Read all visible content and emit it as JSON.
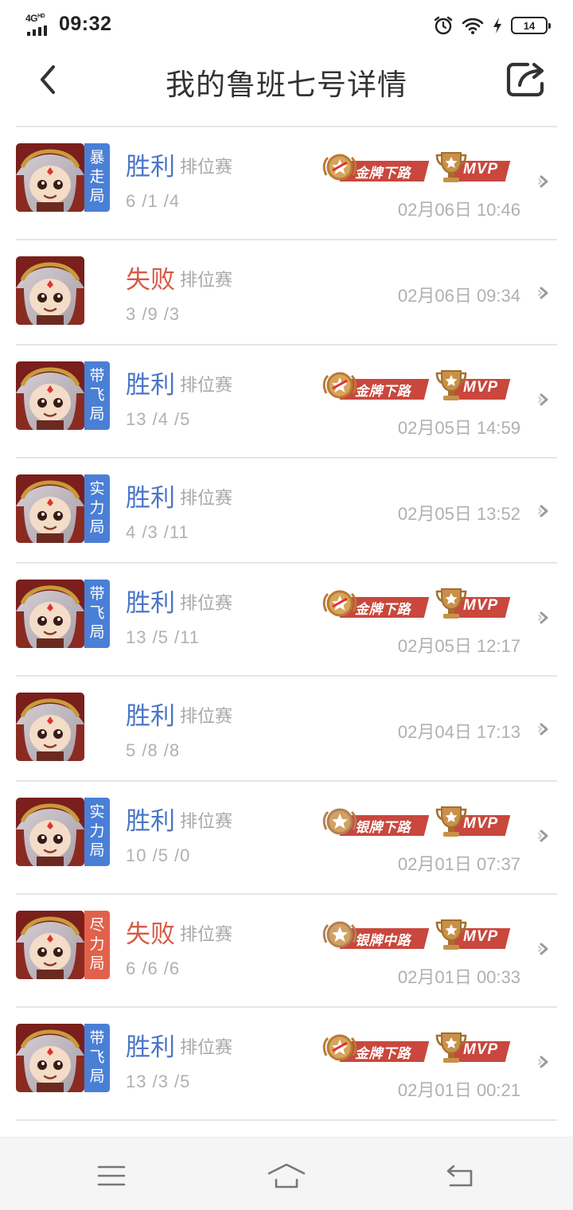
{
  "status_bar": {
    "network": "4G",
    "network_sup": "HD",
    "time": "09:32",
    "battery": "14",
    "icons": [
      "alarm-icon",
      "wifi-icon",
      "charging-icon",
      "battery-icon"
    ]
  },
  "header": {
    "title": "我的鲁班七号详情",
    "back_icon": "back-arrow-icon",
    "share_icon": "share-icon"
  },
  "matches": [
    {
      "tag": "暴走局",
      "tag_color": "blue",
      "result": "胜利",
      "outcome": "win",
      "mode": "排位赛",
      "kda": "6 /1 /4",
      "lane_badge": "金牌下路",
      "lane_tier": "gold",
      "mvp": "MVP",
      "time": "02月06日 10:46"
    },
    {
      "tag": "",
      "tag_color": "",
      "result": "失败",
      "outcome": "lose",
      "mode": "排位赛",
      "kda": "3 /9 /3",
      "lane_badge": "",
      "lane_tier": "",
      "mvp": "",
      "time": "02月06日 09:34"
    },
    {
      "tag": "带飞局",
      "tag_color": "blue",
      "result": "胜利",
      "outcome": "win",
      "mode": "排位赛",
      "kda": "13 /4 /5",
      "lane_badge": "金牌下路",
      "lane_tier": "gold",
      "mvp": "MVP",
      "time": "02月05日 14:59"
    },
    {
      "tag": "实力局",
      "tag_color": "blue",
      "result": "胜利",
      "outcome": "win",
      "mode": "排位赛",
      "kda": "4 /3 /11",
      "lane_badge": "",
      "lane_tier": "",
      "mvp": "",
      "time": "02月05日 13:52"
    },
    {
      "tag": "带飞局",
      "tag_color": "blue",
      "result": "胜利",
      "outcome": "win",
      "mode": "排位赛",
      "kda": "13 /5 /11",
      "lane_badge": "金牌下路",
      "lane_tier": "gold",
      "mvp": "MVP",
      "time": "02月05日 12:17"
    },
    {
      "tag": "",
      "tag_color": "",
      "result": "胜利",
      "outcome": "win",
      "mode": "排位赛",
      "kda": "5 /8 /8",
      "lane_badge": "",
      "lane_tier": "",
      "mvp": "",
      "time": "02月04日 17:13"
    },
    {
      "tag": "实力局",
      "tag_color": "blue",
      "result": "胜利",
      "outcome": "win",
      "mode": "排位赛",
      "kda": "10 /5 /0",
      "lane_badge": "银牌下路",
      "lane_tier": "silver",
      "mvp": "MVP",
      "time": "02月01日 07:37"
    },
    {
      "tag": "尽力局",
      "tag_color": "red",
      "result": "失败",
      "outcome": "lose",
      "mode": "排位赛",
      "kda": "6 /6 /6",
      "lane_badge": "银牌中路",
      "lane_tier": "silver",
      "mvp": "MVP",
      "time": "02月01日 00:33"
    },
    {
      "tag": "带飞局",
      "tag_color": "blue",
      "result": "胜利",
      "outcome": "win",
      "mode": "排位赛",
      "kda": "13 /3 /5",
      "lane_badge": "金牌下路",
      "lane_tier": "gold",
      "mvp": "MVP",
      "time": "02月01日 00:21"
    }
  ],
  "bottom_nav": {
    "icons": [
      "menu-icon",
      "home-icon",
      "back-icon"
    ]
  },
  "colors": {
    "win": "#4a76c8",
    "lose": "#d65a46",
    "tag_blue": "#4a7fd6",
    "tag_red": "#e2614b",
    "badge_ribbon": "#c9473d"
  }
}
